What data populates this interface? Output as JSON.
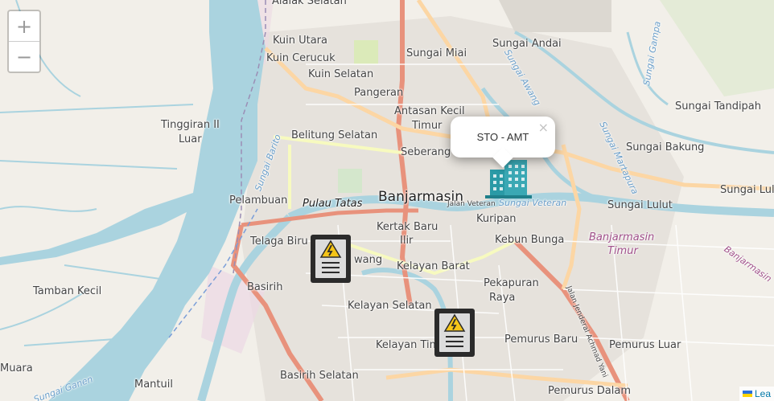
{
  "map": {
    "labels": {
      "alalak_selatan": "Alalak Selatan",
      "kuin_utara": "Kuin Utara",
      "kuin_cerucuk": "Kuin Cerucuk",
      "kuin_selatan": "Kuin Selatan",
      "sungai_miai": "Sungai Miai",
      "sungai_andai": "Sungai Andai",
      "sungai_gampa": "Sungai Gampa",
      "sungai_awang": "Sungai Awang",
      "pangeran": "Pangeran",
      "antasan_kecil_timur_1": "Antasan Kecil",
      "antasan_kecil_timur_2": "Timur",
      "sungai_tandipah": "Sungai Tandipah",
      "tinggiran_1": "Tinggiran II",
      "tinggiran_2": "Luar",
      "sungai_barito": "Sungai Barito",
      "belitung_selatan": "Belitung Selatan",
      "seberang": "Seberang",
      "sungai_bakung": "Sungai Bakung",
      "sungai_martapura": "Sungai Martapura",
      "sungai_lulut_right": "Sungai Lulut",
      "pelambuan": "Pelambuan",
      "pulau_tatas": "Pulau Tatas",
      "banjarmasin": "Banjarmasin",
      "jalan_veteran": "Jalan Veteran",
      "sungai_veteran": "Sungai Veteran",
      "sungai_lulut": "Sungai Lulut",
      "kuripan": "Kuripan",
      "kertak_baru_1": "Kertak Baru",
      "kertak_baru_2": "Ilir",
      "telaga_biru": "Telaga Biru",
      "kebun_bunga": "Kebun Bunga",
      "banjarmasin_timur_1": "Banjarmasin",
      "banjarmasin_timur_2": "Timur",
      "banjarmasin_diag": "Banjarmasin",
      "kelayan_barat": "Kelayan Barat",
      "basirih": "Basirih",
      "tamban_kecil": "Tamban Kecil",
      "pekapuran_1": "Pekapuran",
      "pekapuran_2": "Raya",
      "kelayan_selatan": "Kelayan Selatan",
      "jalan_ahmad_yani": "Jalan Jenderal Achmad Yani",
      "pemurus_baru": "Pemurus Baru",
      "kelayan_timur": "Kelayan Tim",
      "pemurus_luar": "Pemurus Luar",
      "mantuil": "Mantuil",
      "basirih_selatan": "Basirih Selatan",
      "pemurus_dalam": "Pemurus Dalam",
      "muara": "Muara",
      "sungai_ganen": "Sungai Ganen",
      "wang": "wang"
    },
    "zoom_in": "+",
    "zoom_out": "−",
    "attribution": "Lea"
  },
  "popup": {
    "text": "STO - AMT",
    "close": "×"
  },
  "markers": [
    {
      "type": "building",
      "color": "#2a9aa6"
    },
    {
      "type": "electric-panel"
    },
    {
      "type": "electric-panel"
    }
  ]
}
